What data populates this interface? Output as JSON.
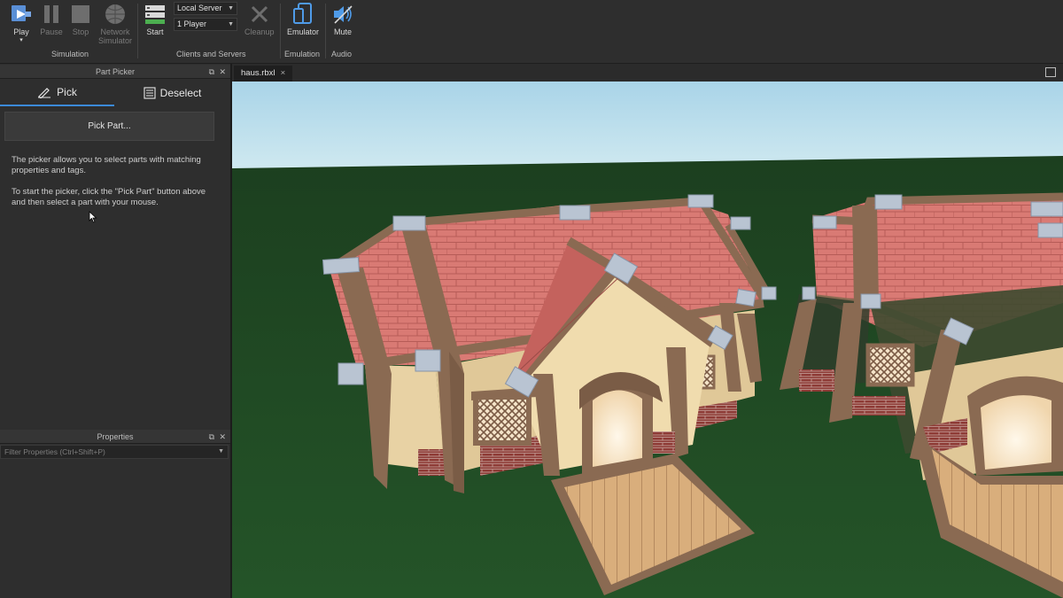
{
  "ribbon": {
    "simulation": {
      "play": "Play",
      "pause": "Pause",
      "stop": "Stop",
      "network_simulator": "Network Simulator",
      "group": "Simulation"
    },
    "clients_servers": {
      "start": "Start",
      "server_mode": "Local Server",
      "players": "1 Player",
      "cleanup": "Cleanup",
      "group": "Clients and Servers"
    },
    "emulation": {
      "emulator": "Emulator",
      "group": "Emulation"
    },
    "audio": {
      "mute": "Mute",
      "group": "Audio"
    }
  },
  "part_picker": {
    "title": "Part Picker",
    "tabs": {
      "pick": "Pick",
      "deselect": "Deselect"
    },
    "pick_button": "Pick Part...",
    "description_1": "The picker allows you to select parts with matching properties and tags.",
    "description_2": "To start the picker, click the \"Pick Part\" button above and then select a part with your mouse."
  },
  "properties": {
    "title": "Properties",
    "filter_placeholder": "Filter Properties (Ctrl+Shift+P)"
  },
  "document": {
    "tab": "haus.rbxl",
    "close": "×"
  },
  "colors": {
    "accent": "#3b8ad9",
    "sky": "#bfe0ee",
    "grass": "#1f4a22",
    "roof": "#d97a74",
    "wall": "#e8d2a4",
    "trim": "#8a6a52",
    "deck": "#d9ae7c",
    "brick": "#8e3b36"
  },
  "icons": [
    "play-icon",
    "pause-icon",
    "stop-icon",
    "network-icon",
    "start-icon",
    "cleanup-icon",
    "emulator-icon",
    "mute-icon",
    "pick-icon",
    "deselect-icon",
    "float-icon",
    "close-icon",
    "maximize-icon",
    "cursor-icon"
  ]
}
